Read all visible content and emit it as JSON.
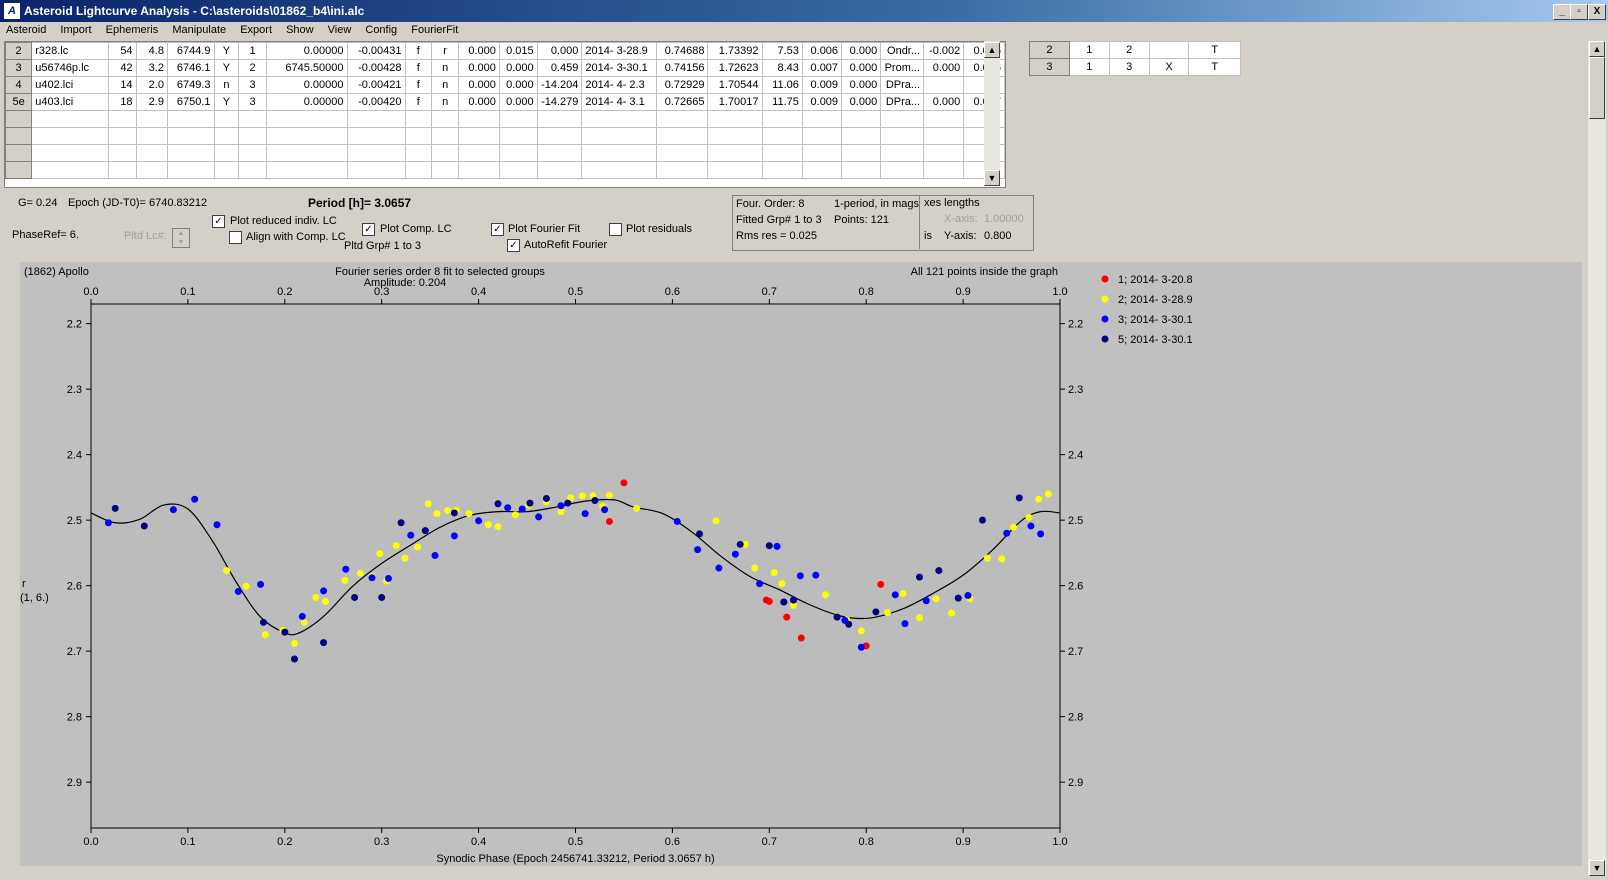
{
  "window": {
    "title": "Asteroid Lightcurve Analysis - C:\\asteroids\\01862_b4\\ini.alc",
    "app_icon": "lightcurve-app-icon",
    "controls": [
      "_",
      "▫",
      "X"
    ]
  },
  "menu": [
    "Asteroid",
    "Import",
    "Ephemeris",
    "Manipulate",
    "Export",
    "Show",
    "View",
    "Config",
    "FourierFit"
  ],
  "lc_table": {
    "rows": [
      [
        "2",
        "r328.lc",
        "54",
        "4.8",
        "6744.9",
        "Y",
        "1",
        "0.00000",
        "-0.00431",
        "f",
        "r",
        "0.000",
        "0.015",
        "0.000",
        "2014- 3-28.9",
        "0.74688",
        "1.73392",
        "7.53",
        "0.006",
        "0.000",
        "Ondr...",
        "-0.002",
        "0.016"
      ],
      [
        "3",
        "u56746p.lc",
        "42",
        "3.2",
        "6746.1",
        "Y",
        "2",
        "6745.50000",
        "-0.00428",
        "f",
        "n",
        "0.000",
        "0.000",
        "0.459",
        "2014- 3-30.1",
        "0.74156",
        "1.72623",
        "8.43",
        "0.007",
        "0.000",
        "Prom...",
        "0.000",
        "0.026"
      ],
      [
        "4",
        "u402.lci",
        "14",
        "2.0",
        "6749.3",
        "n",
        "3",
        "0.00000",
        "-0.00421",
        "f",
        "n",
        "0.000",
        "0.000",
        "-14.204",
        "2014- 4- 2.3",
        "0.72929",
        "1.70544",
        "11.06",
        "0.009",
        "0.000",
        "DPra...",
        "",
        ""
      ],
      [
        "5e",
        "u403.lci",
        "18",
        "2.9",
        "6750.1",
        "Y",
        "3",
        "0.00000",
        "-0.00420",
        "f",
        "n",
        "0.000",
        "0.000",
        "-14.279",
        "2014- 4- 3.1",
        "0.72665",
        "1.70017",
        "11.75",
        "0.009",
        "0.000",
        "DPra...",
        "0.000",
        "0.027"
      ]
    ],
    "empty_rows": 4
  },
  "group_table": {
    "rows": [
      [
        "2",
        "1",
        "2",
        "",
        "T"
      ],
      [
        "3",
        "1",
        "3",
        "X",
        "T"
      ]
    ]
  },
  "controls": {
    "g_value": "G= 0.24",
    "epoch": "Epoch (JD-T0)= 6740.83212",
    "period": "Period [h]= 3.0657",
    "phase_ref": "PhaseRef= 6.",
    "pltd_lc": "Pltd Lc#:",
    "plot_reduced": "Plot reduced indiv. LC",
    "align_comp": "Align with Comp. LC",
    "plot_comp": "Plot Comp. LC",
    "pltd_grp": "Pltd Grp#  1   to   3",
    "plot_fourier": "Plot Fourier Fit",
    "autorefit": "AutoRefit Fourier",
    "plot_residuals": "Plot residuals",
    "plot_reduced_checked": true,
    "align_comp_checked": false,
    "plot_comp_checked": true,
    "plot_fourier_checked": true,
    "autorefit_checked": true,
    "plot_residuals_checked": false
  },
  "stats": {
    "four_order": "Four. Order:  8",
    "one_period": "1-period, in mags",
    "fitted_grp": "Fitted Grp# 1 to 3",
    "points": "Points: 121",
    "rms_res": "Rms res    = 0.025",
    "axes_lengths": "xes lengths",
    "x_axis_label": "X-axis:",
    "x_axis_value": "1.00000",
    "y_axis_label": "Y-axis:",
    "y_axis_value": "0.800",
    "is": "is"
  },
  "chart_data": {
    "type": "scatter",
    "object": "(1862) Apollo",
    "title": "Fourier series order 8 fit to selected groups",
    "amplitude": "Amplitude: 0.204",
    "points_note": "All 121 points inside the graph",
    "xlabel": "Synodic Phase (Epoch 2456741.33212, Period 3.0657 h)",
    "ylabel": "r",
    "ylabel2": "(1, 6.)",
    "xlim": [
      0.0,
      1.0
    ],
    "ylim": [
      2.17,
      2.97
    ],
    "y_inverted": true,
    "xticks": [
      "0.0",
      "0.1",
      "0.2",
      "0.3",
      "0.4",
      "0.5",
      "0.6",
      "0.7",
      "0.8",
      "0.9",
      "1.0"
    ],
    "yticks": [
      "2.2",
      "2.3",
      "2.4",
      "2.5",
      "2.6",
      "2.7",
      "2.8",
      "2.9"
    ],
    "legend_position": "top-right",
    "series": [
      {
        "name": "1; 2014- 3-20.8",
        "color": "#ff0000",
        "x": [
          0.535,
          0.55,
          0.697,
          0.7,
          0.718,
          0.733,
          0.8,
          0.815
        ],
        "y": [
          2.502,
          2.443,
          2.622,
          2.624,
          2.648,
          2.68,
          2.692,
          2.598
        ]
      },
      {
        "name": "2; 2014- 3-28.9",
        "color": "#ffff00",
        "x": [
          0.14,
          0.16,
          0.18,
          0.198,
          0.21,
          0.22,
          0.232,
          0.242,
          0.262,
          0.278,
          0.29,
          0.298,
          0.305,
          0.315,
          0.324,
          0.337,
          0.348,
          0.357,
          0.368,
          0.377,
          0.39,
          0.41,
          0.42,
          0.438,
          0.452,
          0.47,
          0.485,
          0.495,
          0.507,
          0.518,
          0.528,
          0.535,
          0.563,
          0.645,
          0.675,
          0.685,
          0.705,
          0.713,
          0.725,
          0.758,
          0.78,
          0.795,
          0.822,
          0.838,
          0.855,
          0.872,
          0.888,
          0.907,
          0.925,
          0.94,
          0.952,
          0.968,
          0.978,
          0.988
        ],
        "y": [
          2.577,
          2.601,
          2.675,
          2.668,
          2.688,
          2.656,
          2.618,
          2.624,
          2.592,
          2.581,
          2.586,
          2.551,
          2.593,
          2.539,
          2.558,
          2.541,
          2.475,
          2.49,
          2.485,
          2.485,
          2.49,
          2.507,
          2.51,
          2.492,
          2.477,
          2.472,
          2.487,
          2.466,
          2.463,
          2.463,
          2.479,
          2.462,
          2.482,
          2.501,
          2.537,
          2.573,
          2.58,
          2.597,
          2.63,
          2.614,
          2.652,
          2.669,
          2.641,
          2.612,
          2.649,
          2.62,
          2.642,
          2.62,
          2.558,
          2.559,
          2.511,
          2.496,
          2.468,
          2.46
        ]
      },
      {
        "name": "3; 2014- 3-30.1",
        "color": "#0000ff",
        "x": [
          0.018,
          0.085,
          0.107,
          0.13,
          0.152,
          0.175,
          0.218,
          0.24,
          0.263,
          0.29,
          0.307,
          0.33,
          0.355,
          0.375,
          0.4,
          0.43,
          0.445,
          0.462,
          0.485,
          0.51,
          0.53,
          0.605,
          0.626,
          0.648,
          0.665,
          0.69,
          0.708,
          0.715,
          0.725,
          0.732,
          0.748,
          0.778,
          0.795,
          0.83,
          0.84,
          0.862,
          0.905,
          0.945,
          0.97,
          0.98
        ],
        "y": [
          2.504,
          2.484,
          2.468,
          2.507,
          2.609,
          2.598,
          2.647,
          2.608,
          2.575,
          2.588,
          2.589,
          2.523,
          2.554,
          2.524,
          2.501,
          2.481,
          2.483,
          2.495,
          2.478,
          2.49,
          2.484,
          2.502,
          2.545,
          2.573,
          2.552,
          2.597,
          2.54,
          2.625,
          2.622,
          2.585,
          2.584,
          2.653,
          2.694,
          2.614,
          2.658,
          2.623,
          2.615,
          2.52,
          2.509,
          2.521
        ]
      },
      {
        "name": "5; 2014- 3-30.1",
        "color": "#000080",
        "x": [
          0.025,
          0.055,
          0.178,
          0.2,
          0.21,
          0.24,
          0.272,
          0.3,
          0.32,
          0.345,
          0.375,
          0.42,
          0.453,
          0.47,
          0.492,
          0.52,
          0.628,
          0.67,
          0.7,
          0.715,
          0.725,
          0.77,
          0.782,
          0.81,
          0.855,
          0.875,
          0.895,
          0.92,
          0.958
        ],
        "y": [
          2.482,
          2.509,
          2.656,
          2.671,
          2.712,
          2.687,
          2.618,
          2.618,
          2.504,
          2.516,
          2.489,
          2.475,
          2.474,
          2.467,
          2.474,
          2.47,
          2.521,
          2.537,
          2.539,
          2.625,
          2.622,
          2.648,
          2.659,
          2.64,
          2.587,
          2.577,
          2.619,
          2.5,
          2.466
        ]
      }
    ],
    "fit": {
      "x": [
        0.0,
        0.025,
        0.05,
        0.075,
        0.1,
        0.125,
        0.15,
        0.175,
        0.2,
        0.215,
        0.24,
        0.27,
        0.3,
        0.33,
        0.36,
        0.39,
        0.42,
        0.45,
        0.48,
        0.51,
        0.54,
        0.56,
        0.59,
        0.62,
        0.65,
        0.68,
        0.71,
        0.74,
        0.77,
        0.79,
        0.81,
        0.84,
        0.87,
        0.9,
        0.93,
        0.96,
        0.98,
        1.0
      ],
      "y": [
        2.489,
        2.504,
        2.499,
        2.477,
        2.483,
        2.531,
        2.595,
        2.648,
        2.672,
        2.672,
        2.647,
        2.601,
        2.566,
        2.538,
        2.511,
        2.493,
        2.487,
        2.487,
        2.48,
        2.471,
        2.469,
        2.48,
        2.49,
        2.518,
        2.555,
        2.586,
        2.606,
        2.628,
        2.645,
        2.65,
        2.648,
        2.634,
        2.611,
        2.584,
        2.546,
        2.501,
        2.487,
        2.489
      ]
    }
  }
}
